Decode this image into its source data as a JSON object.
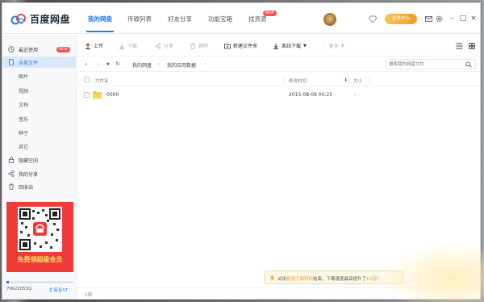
{
  "app": {
    "name": "百度网盘",
    "brand_color": "#2a7be4",
    "nav_tabs": [
      {
        "label": "我的网盘",
        "active": true
      },
      {
        "label": "传输列表",
        "active": false
      },
      {
        "label": "好友分享",
        "active": false
      },
      {
        "label": "功能宝箱",
        "active": false
      },
      {
        "label": "找资源",
        "active": false
      }
    ],
    "new_badge": "NEW",
    "vip_button": "会员中心"
  },
  "sidebar": {
    "items": [
      {
        "label": "最近使用",
        "icon": "clock-icon",
        "badge": "NEW"
      },
      {
        "label": "全部文件",
        "icon": "file-icon",
        "active": true
      },
      {
        "label": "图片"
      },
      {
        "label": "视频"
      },
      {
        "label": "文档"
      },
      {
        "label": "音乐"
      },
      {
        "label": "种子"
      },
      {
        "label": "其它"
      },
      {
        "label": "隐藏空间",
        "icon": "lock-icon"
      },
      {
        "label": "我的分享",
        "icon": "share-icon"
      },
      {
        "label": "回收站",
        "icon": "trash-icon"
      }
    ],
    "promo_text": "免费领超级会员",
    "storage_text": "79G/2053G",
    "storage_fraction": 0.038,
    "expand_link": "扩容至5T"
  },
  "toolbar": {
    "upload": "上传",
    "download": "下载",
    "share": "分享",
    "delete": "删除",
    "new_folder": "新建文件夹",
    "offline_download": "离线下载",
    "more": "更多"
  },
  "addressbar": {
    "crumbs": [
      "我的网盘",
      "我的应用数据"
    ],
    "search_placeholder": "搜索我的网盘文件"
  },
  "table": {
    "columns": [
      "文件名",
      "修改时间",
      "大小"
    ],
    "rows": [
      {
        "name": "0000",
        "modified": "2015-08-09 00:25",
        "size": "-"
      }
    ]
  },
  "status": {
    "item_count": "1项"
  },
  "toast": {
    "pre": "试用",
    "highlight1": "极速下载特权",
    "mid": "结束，下载速度最高提升了",
    "highlight2": "15倍",
    "post": "！"
  }
}
